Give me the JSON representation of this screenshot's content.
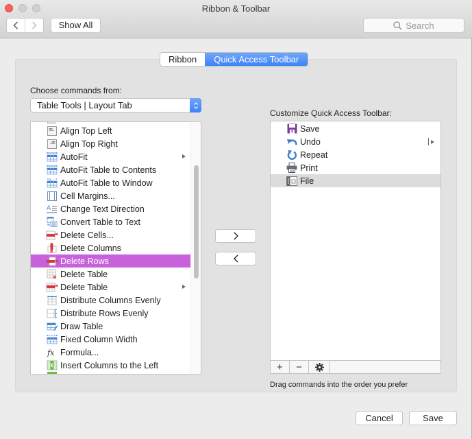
{
  "window": {
    "title": "Ribbon & Toolbar",
    "show_all_label": "Show All",
    "search_placeholder": "Search"
  },
  "tabs": [
    {
      "label": "Ribbon",
      "active": false
    },
    {
      "label": "Quick Access Toolbar",
      "active": true
    }
  ],
  "left": {
    "choose_label": "Choose commands from:",
    "source_value": "Table Tools | Layout Tab",
    "commands": [
      {
        "label": "Align Top Left",
        "icon": "align-top-left-icon",
        "submenu": false
      },
      {
        "label": "Align Top Right",
        "icon": "align-top-right-icon",
        "submenu": false
      },
      {
        "label": "AutoFit",
        "icon": "autofit-icon",
        "submenu": true
      },
      {
        "label": "AutoFit Table to Contents",
        "icon": "autofit-contents-icon",
        "submenu": false
      },
      {
        "label": "AutoFit Table to Window",
        "icon": "autofit-window-icon",
        "submenu": false
      },
      {
        "label": "Cell Margins...",
        "icon": "cell-margins-icon",
        "submenu": false
      },
      {
        "label": "Change Text Direction",
        "icon": "text-direction-icon",
        "submenu": false
      },
      {
        "label": "Convert Table to Text",
        "icon": "convert-table-icon",
        "submenu": false
      },
      {
        "label": "Delete Cells...",
        "icon": "delete-cells-icon",
        "submenu": false
      },
      {
        "label": "Delete Columns",
        "icon": "delete-columns-icon",
        "submenu": false
      },
      {
        "label": "Delete Rows",
        "icon": "delete-rows-icon",
        "submenu": false,
        "selected": true
      },
      {
        "label": "Delete Table",
        "icon": "delete-table-icon",
        "submenu": false
      },
      {
        "label": "Delete Table",
        "icon": "delete-table-menu-icon",
        "submenu": true
      },
      {
        "label": "Distribute Columns Evenly",
        "icon": "distribute-columns-icon",
        "submenu": false
      },
      {
        "label": "Distribute Rows Evenly",
        "icon": "distribute-rows-icon",
        "submenu": false
      },
      {
        "label": "Draw Table",
        "icon": "draw-table-icon",
        "submenu": false
      },
      {
        "label": "Fixed Column Width",
        "icon": "fixed-column-width-icon",
        "submenu": false
      },
      {
        "label": "Formula...",
        "icon": "formula-icon",
        "submenu": false
      },
      {
        "label": "Insert Columns to the Left",
        "icon": "insert-columns-left-icon",
        "submenu": false
      }
    ]
  },
  "middle": {
    "add_symbol": "›",
    "remove_symbol": "‹"
  },
  "right": {
    "customize_label": "Customize Quick Access Toolbar:",
    "items": [
      {
        "label": "Save",
        "icon": "save-icon"
      },
      {
        "label": "Undo",
        "icon": "undo-icon",
        "split": true
      },
      {
        "label": "Repeat",
        "icon": "repeat-icon"
      },
      {
        "label": "Print",
        "icon": "print-icon"
      },
      {
        "label": "File",
        "icon": "file-icon",
        "selected": true
      }
    ],
    "add_label": "+",
    "remove_label": "−",
    "hint": "Drag commands into the order you prefer"
  },
  "buttons": {
    "cancel": "Cancel",
    "save": "Save"
  },
  "colors": {
    "accent_blue": "#3e82f7",
    "selection_purple": "#c862dc",
    "close_red": "#fc605c"
  }
}
